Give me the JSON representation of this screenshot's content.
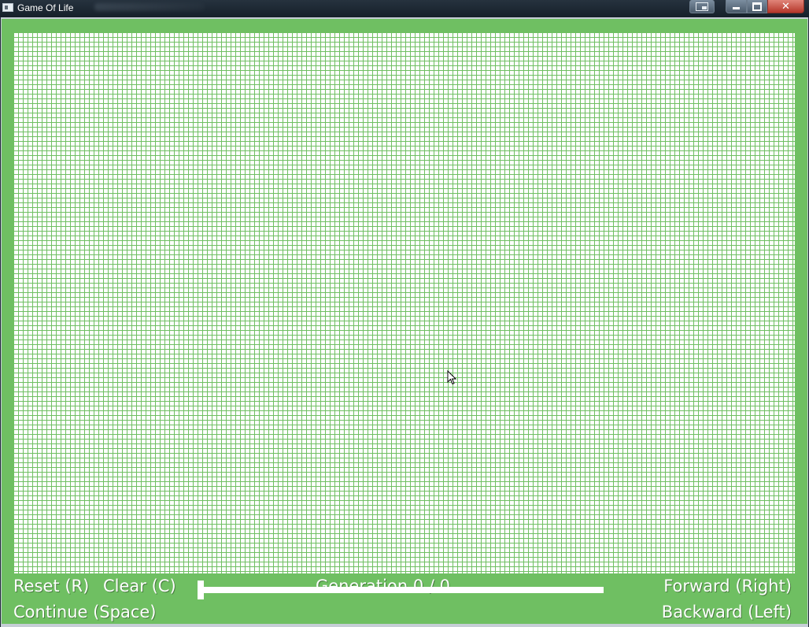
{
  "window": {
    "title": "Game Of Life"
  },
  "board": {
    "cell_state": "all dead",
    "colors": {
      "background": "#6fbf62",
      "dead_cell": "#ffffff",
      "grid_line": "#6fbf62"
    }
  },
  "controls": {
    "reset_label": "Reset (R)",
    "clear_label": "Clear (C)",
    "continue_label": "Continue (Space)",
    "generation_label": "Generation 0 / 0",
    "forward_label": "Forward (Right)",
    "backward_label": "Backward (Left)",
    "slider": {
      "value": 0,
      "max": 0
    }
  }
}
